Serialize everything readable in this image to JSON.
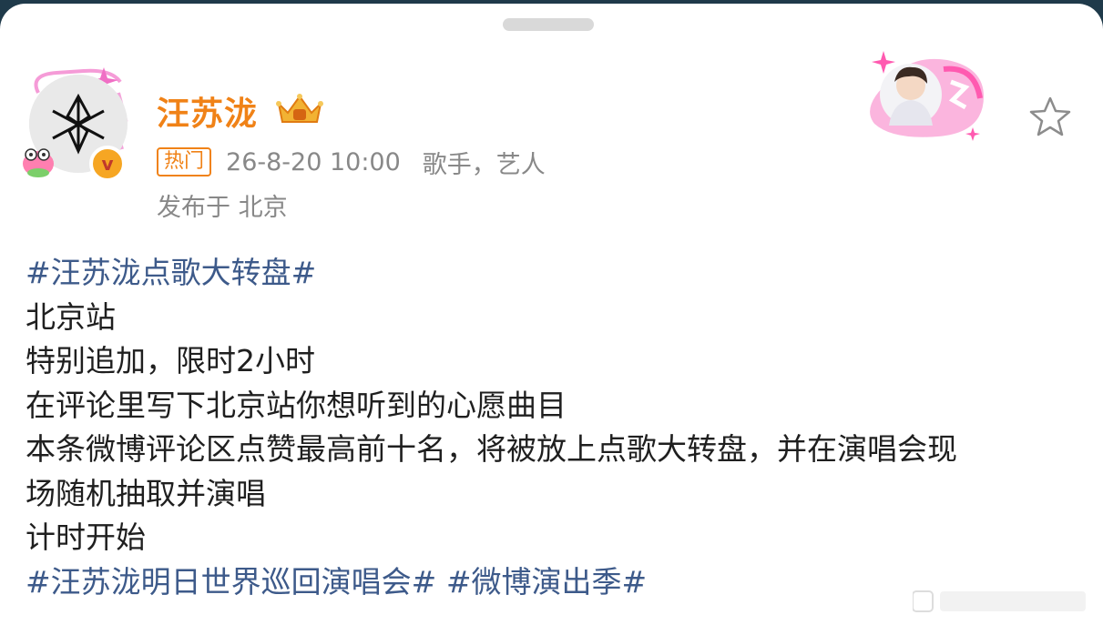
{
  "sheet": {
    "handle": "drag-handle"
  },
  "author": {
    "name": "汪苏泷",
    "hot_tag": "热门",
    "time": "26-8-20 10:00",
    "description": "歌手，艺人",
    "location": "发布于 北京"
  },
  "post": {
    "topic_1": "#汪苏泷点歌大转盘#",
    "lines": [
      "北京站",
      "特别追加，限时2小时",
      "在评论里写下北京站你想听到的心愿曲目",
      "本条微博评论区点赞最高前十名，将被放上点歌大转盘，并在演唱会现",
      "场随机抽取并演唱",
      "计时开始"
    ],
    "topic_2": "#汪苏泷明日世界巡回演唱会#",
    "topic_3": "#微博演出季#"
  },
  "icons": [
    "avatar",
    "verified-v-icon",
    "crown-badge-icon",
    "star-icon",
    "sticker-card"
  ],
  "colors": {
    "username": "#f08217",
    "topic": "#3d5a8a",
    "meta": "#888888"
  }
}
